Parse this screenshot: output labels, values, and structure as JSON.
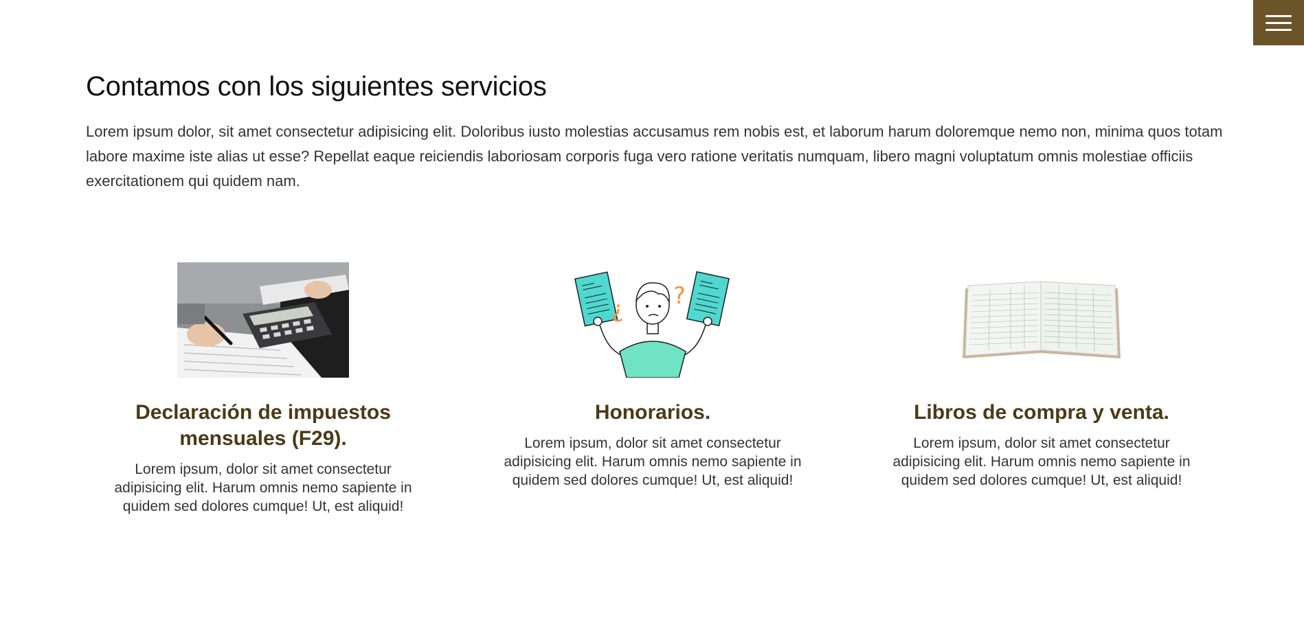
{
  "menu": {
    "icon": "hamburger-menu-icon",
    "color": "#6b5428"
  },
  "services": {
    "title": "Contamos con los siguientes servicios",
    "intro": "Lorem ipsum dolor, sit amet consectetur adipisicing elit. Doloribus iusto molestias accusamus rem nobis est, et laborum harum doloremque nemo non, minima quos totam labore maxime iste alias ut esse? Repellat eaque reiciendis laboriosam corporis fuga vero ratione veritatis numquam, libero magni voluptatum omnis molestiae officiis exercitationem qui quidem nam.",
    "accent_color": "#4b3a16",
    "items": [
      {
        "image": "tax-calculator-photo",
        "title": "Declaración de impuestos mensuales (F29).",
        "text": "Lorem ipsum, dolor sit amet consectetur adipisicing elit. Harum omnis nemo sapiente in quidem sed dolores cumque! Ut, est aliquid!"
      },
      {
        "image": "confused-person-illustration",
        "title": "Honorarios.",
        "text": "Lorem ipsum, dolor sit amet consectetur adipisicing elit. Harum omnis nemo sapiente in quidem sed dolores cumque! Ut, est aliquid!"
      },
      {
        "image": "ledger-book-photo",
        "title": "Libros de compra y venta.",
        "text": "Lorem ipsum, dolor sit amet consectetur adipisicing elit. Harum omnis nemo sapiente in quidem sed dolores cumque! Ut, est aliquid!"
      }
    ]
  }
}
